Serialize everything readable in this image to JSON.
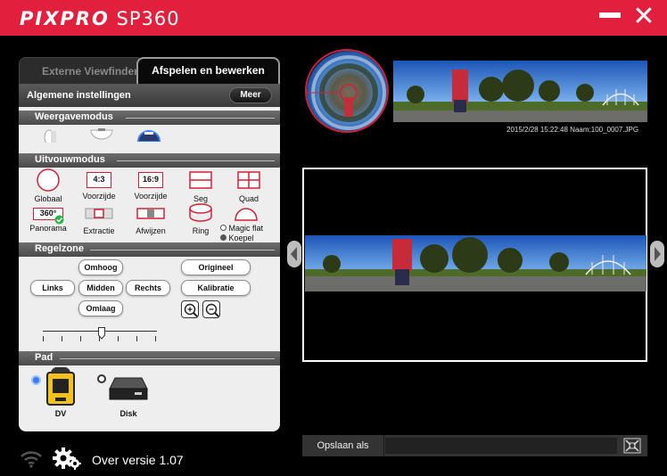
{
  "app": {
    "logo_brand": "PIXPRO",
    "logo_model": "SP360"
  },
  "window": {
    "minimize_label": "",
    "close_label": "✕"
  },
  "tabs": [
    {
      "label": "Externe Viewfinder",
      "active": false
    },
    {
      "label": "Afspelen en bewerken",
      "active": true
    }
  ],
  "settings": {
    "title": "Algemene instellingen",
    "more_label": "Meer"
  },
  "view_mode": {
    "title": "Weergavemodus",
    "selected": 2
  },
  "unfold_mode": {
    "title": "Uitvouwmodus",
    "row1": [
      {
        "label": "Globaal",
        "icon_text": ""
      },
      {
        "label": "Voorzijde",
        "icon_text": "4:3"
      },
      {
        "label": "Voorzijde",
        "icon_text": "16:9"
      },
      {
        "label": "Seg",
        "icon_text": ""
      },
      {
        "label": "Quad",
        "icon_text": ""
      }
    ],
    "row2": [
      {
        "label": "Panorama",
        "icon_text": "360°"
      },
      {
        "label": "Extractie",
        "icon_text": ""
      },
      {
        "label": "Afwijzen",
        "icon_text": ""
      },
      {
        "label": "Ring",
        "icon_text": ""
      }
    ],
    "dome_options": [
      "Magic flat",
      "Koepel"
    ],
    "dome_selected": 1
  },
  "control_zone": {
    "title": "Regelzone",
    "up": "Omhoog",
    "left": "Links",
    "center": "Midden",
    "right": "Rechts",
    "down": "Omlaag",
    "original": "Origineel",
    "calibrate": "Kalibratie",
    "slider_value": 0.5
  },
  "path": {
    "title": "Pad",
    "options": [
      {
        "label": "DV"
      },
      {
        "label": "Disk"
      }
    ],
    "selected": 0
  },
  "preview": {
    "caption": "2015/2/28 15:22:48 Naam:100_0007.JPG"
  },
  "save": {
    "label": "Opslaan als",
    "value": ""
  },
  "footer": {
    "version": "Over versie 1.07"
  },
  "colors": {
    "accent": "#e0203c",
    "panel_bg": "#eeeeee",
    "ring_red": "#d0203a"
  },
  "icons": {
    "wifi": "wifi-icon",
    "gear": "gear-icon",
    "zoom_in": "zoom-in-icon",
    "zoom_out": "zoom-out-icon",
    "fullscreen": "fullscreen-icon"
  }
}
